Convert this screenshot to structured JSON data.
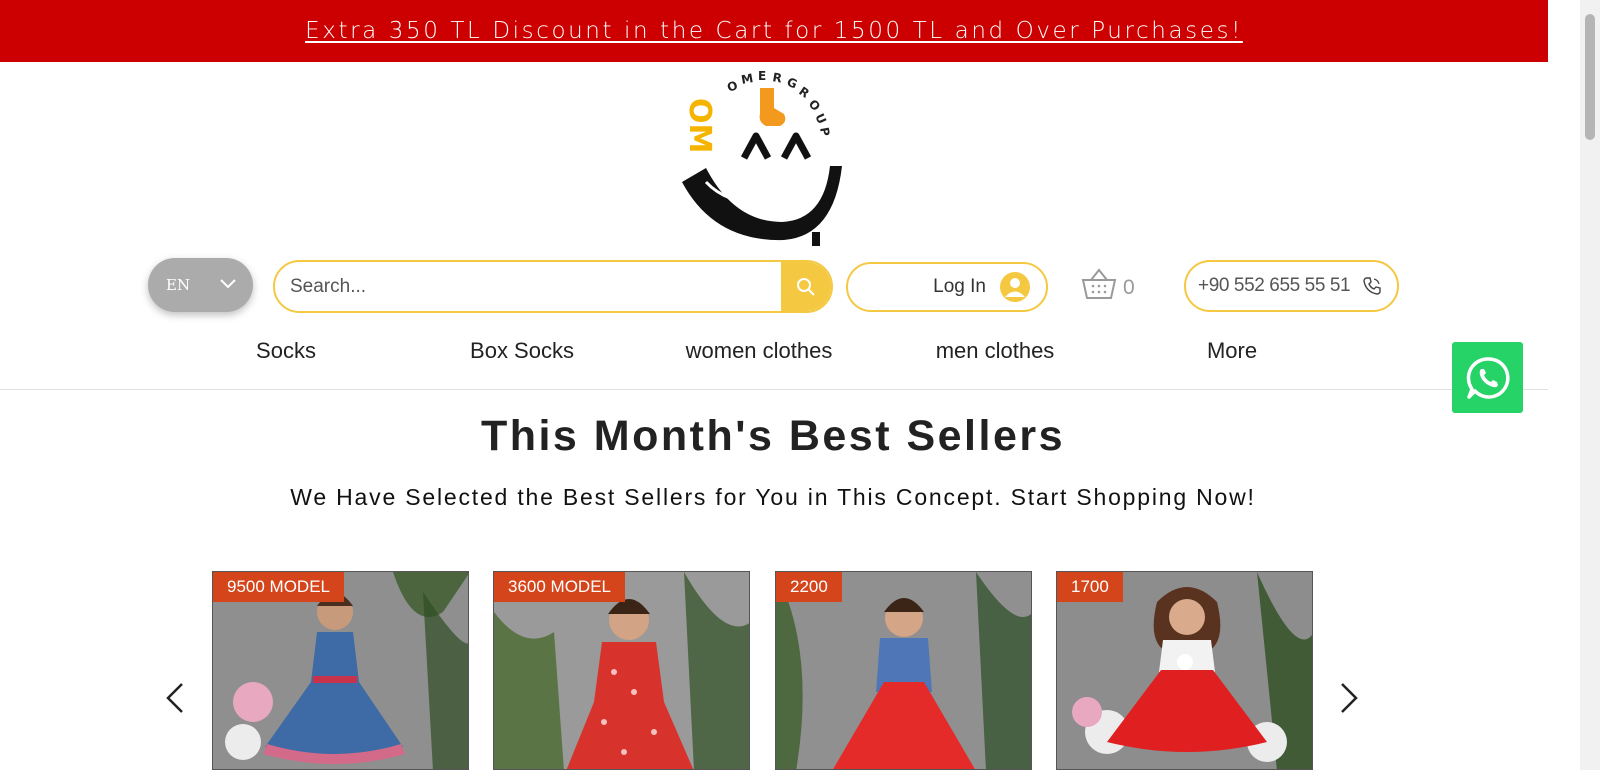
{
  "promo": {
    "text": "Extra 350 TL Discount in the Cart for 1500 TL and Over Purchases!"
  },
  "header": {
    "logo_text": "OMERGROUP",
    "language": "EN",
    "search_placeholder": "Search...",
    "login_label": "Log In",
    "cart_count": "0",
    "phone": "+90 552 655 55 51"
  },
  "nav": {
    "items": [
      "Socks",
      "Box Socks",
      "women clothes",
      "men clothes",
      "More"
    ]
  },
  "section": {
    "title": "This Month's Best Sellers",
    "subtitle": "We Have Selected the Best Sellers for You in This Concept. Start Shopping Now!"
  },
  "products": [
    {
      "badge": "9500 MODEL",
      "dress_color": "#3e6aa6"
    },
    {
      "badge": "3600 MODEL",
      "dress_color": "#d8322c"
    },
    {
      "badge": "2200",
      "dress_color": "#e52a2a"
    },
    {
      "badge": "1700",
      "dress_color": "#e02020"
    }
  ],
  "colors": {
    "promo_bg": "#cc0000",
    "accent": "#f5c842",
    "badge_bg": "#d5451b",
    "whatsapp": "#25d366"
  },
  "icons": [
    "chevron-down-icon",
    "search-icon",
    "user-avatar-icon",
    "cart-icon",
    "phone-icon",
    "whatsapp-icon",
    "chevron-left-icon",
    "chevron-right-icon"
  ]
}
